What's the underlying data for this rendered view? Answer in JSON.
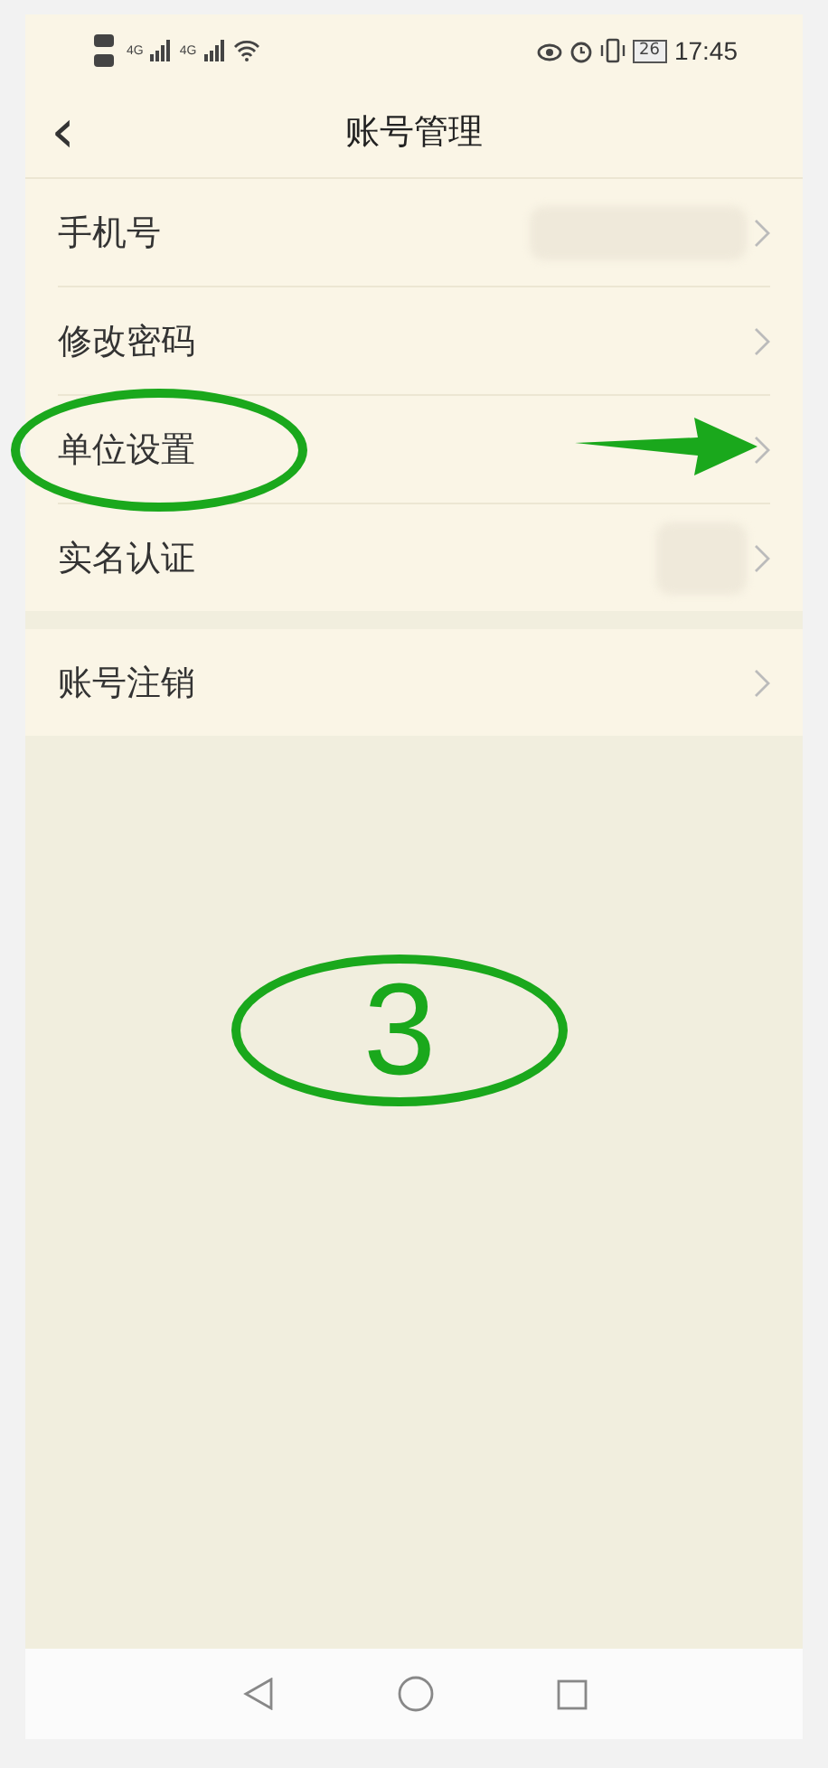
{
  "status_bar": {
    "network_1": "4G",
    "network_2": "4G",
    "battery": "26",
    "time": "17:45"
  },
  "header": {
    "back": "‹",
    "title": "账号管理"
  },
  "groups": [
    {
      "rows": [
        {
          "label": "手机号",
          "value_hidden": true,
          "circled": false,
          "arrow": false
        },
        {
          "label": "修改密码",
          "value_hidden": false,
          "circled": false,
          "arrow": false
        },
        {
          "label": "单位设置",
          "value_hidden": false,
          "circled": true,
          "arrow": true
        },
        {
          "label": "实名认证",
          "value_hidden": true,
          "circled": false,
          "arrow": false
        }
      ]
    },
    {
      "rows": [
        {
          "label": "账号注销",
          "value_hidden": false,
          "circled": false,
          "arrow": false
        }
      ]
    }
  ],
  "annotations": {
    "step_number": "3"
  }
}
